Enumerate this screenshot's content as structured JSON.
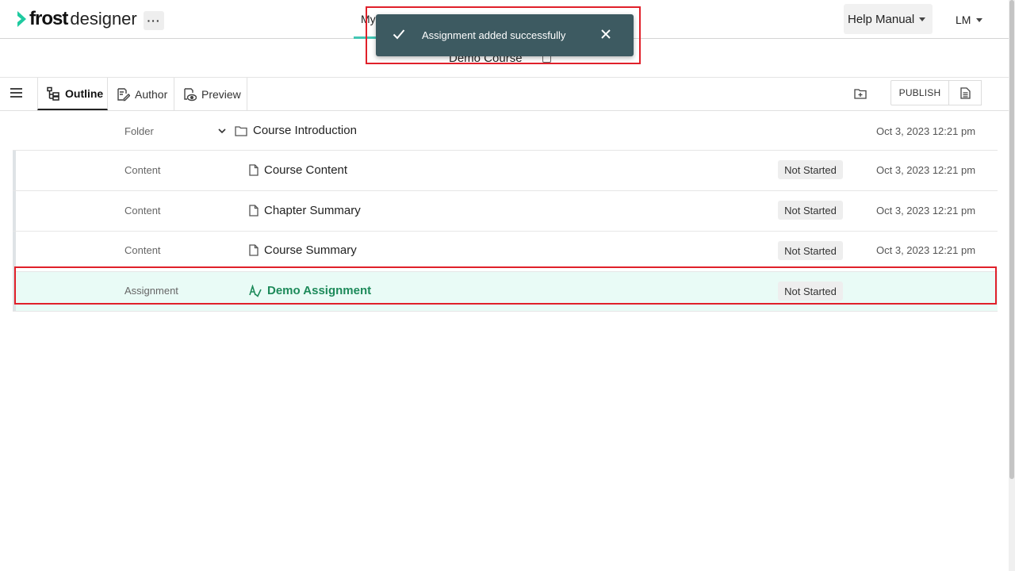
{
  "header": {
    "brand_bold": "frost",
    "brand_light": "designer",
    "more_label": "···",
    "nav_left_partial": "My",
    "nav_right_partial": "s",
    "help_label": "Help Manual",
    "user_initials": "LM"
  },
  "course": {
    "title": "Demo Course"
  },
  "toolbar": {
    "tabs": [
      {
        "label": "Outline",
        "active": true
      },
      {
        "label": "Author"
      },
      {
        "label": "Preview"
      }
    ],
    "publish_label": "PUBLISH"
  },
  "rows": [
    {
      "type": "Folder",
      "name": "Course Introduction",
      "status": "",
      "date": "Oct 3, 2023 12:21 pm",
      "icon": "folder-icon"
    },
    {
      "type": "Content",
      "name": "Course Content",
      "status": "Not Started",
      "date": "Oct 3, 2023 12:21 pm",
      "icon": "document-icon"
    },
    {
      "type": "Content",
      "name": "Chapter Summary",
      "status": "Not Started",
      "date": "Oct 3, 2023 12:21 pm",
      "icon": "document-icon"
    },
    {
      "type": "Content",
      "name": "Course Summary",
      "status": "Not Started",
      "date": "Oct 3, 2023 12:21 pm",
      "icon": "document-icon"
    },
    {
      "type": "Assignment",
      "name": "Demo Assignment",
      "status": "Not Started",
      "date": "",
      "icon": "assignment-icon",
      "selected": true
    }
  ],
  "toast": {
    "message": "Assignment added successfully"
  },
  "colors": {
    "accent_teal": "#43c6b4",
    "toast_bg": "#3d5a61",
    "assignment_green": "#1d8a5a",
    "selected_row_bg": "#e9fbf6",
    "highlight_red": "#e0202a"
  }
}
